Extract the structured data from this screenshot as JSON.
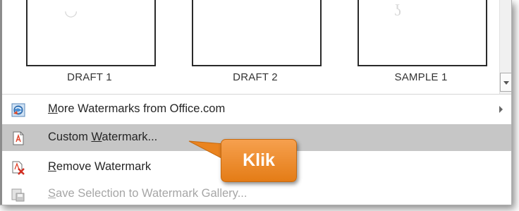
{
  "gallery": {
    "items": [
      {
        "label": "DRAFT 1"
      },
      {
        "label": "DRAFT 2"
      },
      {
        "label": "SAMPLE 1"
      }
    ]
  },
  "menu": {
    "items": [
      {
        "label_pre": "",
        "label_mn": "M",
        "label_post": "ore Watermarks from Office.com",
        "icon": "office-globe-icon",
        "has_submenu": true,
        "state": "normal"
      },
      {
        "label_pre": "Custom ",
        "label_mn": "W",
        "label_post": "atermark...",
        "icon": "custom-watermark-icon",
        "state": "highlighted"
      },
      {
        "label_pre": "",
        "label_mn": "R",
        "label_post": "emove Watermark",
        "icon": "remove-watermark-icon",
        "state": "normal"
      },
      {
        "label_pre": "",
        "label_mn": "S",
        "label_post": "ave Selection to Watermark Gallery...",
        "icon": "save-selection-icon",
        "state": "disabled"
      }
    ]
  },
  "callout": {
    "text": "Klik",
    "color": "#ee8a2a"
  }
}
